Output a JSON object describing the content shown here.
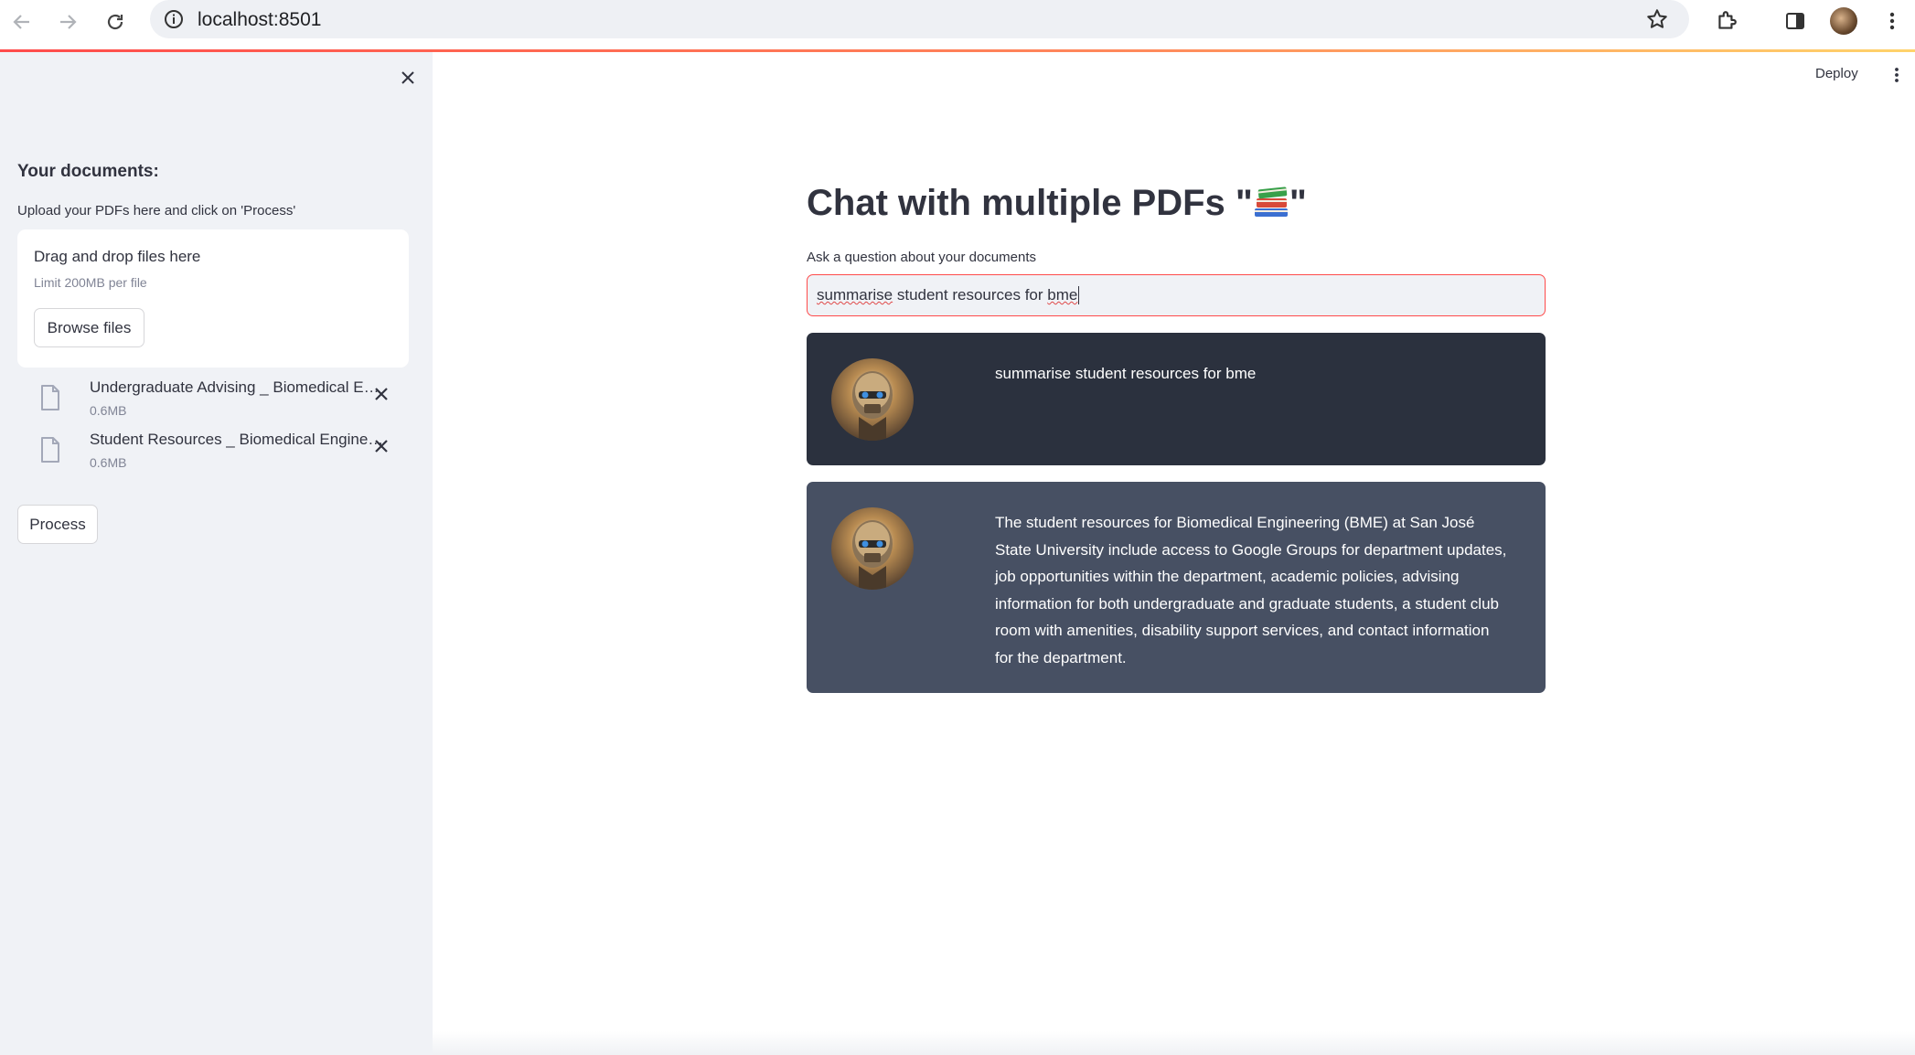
{
  "browser": {
    "url": "localhost:8501"
  },
  "sidebar": {
    "title": "Your documents:",
    "hint": "Upload your PDFs here and click on 'Process'",
    "dropzone": {
      "title": "Drag and drop files here",
      "limit": "Limit 200MB per file",
      "browse_label": "Browse files"
    },
    "files": [
      {
        "name": "Undergraduate Advising _ Biomedical Engineering.pdf",
        "size": "0.6MB"
      },
      {
        "name": "Student Resources _ Biomedical Engineering.pdf",
        "size": "0.6MB"
      }
    ],
    "process_label": "Process"
  },
  "header": {
    "deploy_label": "Deploy"
  },
  "main": {
    "title_prefix": "Chat with multiple PDFs \"",
    "title_suffix": "\"",
    "title_emoji": "books-emoji",
    "question_label": "Ask a question about your documents",
    "question_value_word1": "summarise",
    "question_value_mid": " student resources for ",
    "question_value_word2": "bme"
  },
  "chat": [
    {
      "role": "user",
      "text": "summarise student resources for bme"
    },
    {
      "role": "bot",
      "text": "The student resources for Biomedical Engineering (BME) at San José State University include access to Google Groups for department updates, job opportunities within the department, academic policies, advising information for both undergraduate and graduate students, a student club room with amenities, disability support services, and contact information for the department."
    }
  ],
  "colors": {
    "accent": "#ff4b4b",
    "sidebar_bg": "#f0f2f6",
    "user_msg_bg": "#2b313e",
    "bot_msg_bg": "#475063"
  }
}
